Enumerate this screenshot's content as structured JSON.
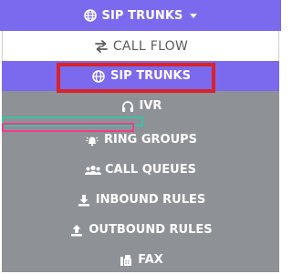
{
  "toggle": {
    "label": "SIP TRUNKS",
    "icon": "globe-icon",
    "caret_icon": "caret-down-icon"
  },
  "menu": {
    "items": [
      {
        "label": "CALL FLOW",
        "icon": "exchange-arrows-icon"
      },
      {
        "label": "SIP TRUNKS",
        "icon": "globe-icon",
        "active": true
      },
      {
        "label": "IVR",
        "icon": "headphones-icon"
      },
      {
        "label": "RING GROUPS",
        "icon": "bell-ring-icon"
      },
      {
        "label": "CALL QUEUES",
        "icon": "users-icon"
      },
      {
        "label": "INBOUND RULES",
        "icon": "download-icon"
      },
      {
        "label": "OUTBOUND RULES",
        "icon": "upload-icon"
      },
      {
        "label": "FAX",
        "icon": "fax-icon"
      }
    ]
  },
  "colors": {
    "accent": "#7b69ee",
    "menu_background": "#8e9195",
    "highlight_red": "#d9232a",
    "annotation_teal": "#39c1a6",
    "annotation_pink": "#ee3c8d"
  }
}
